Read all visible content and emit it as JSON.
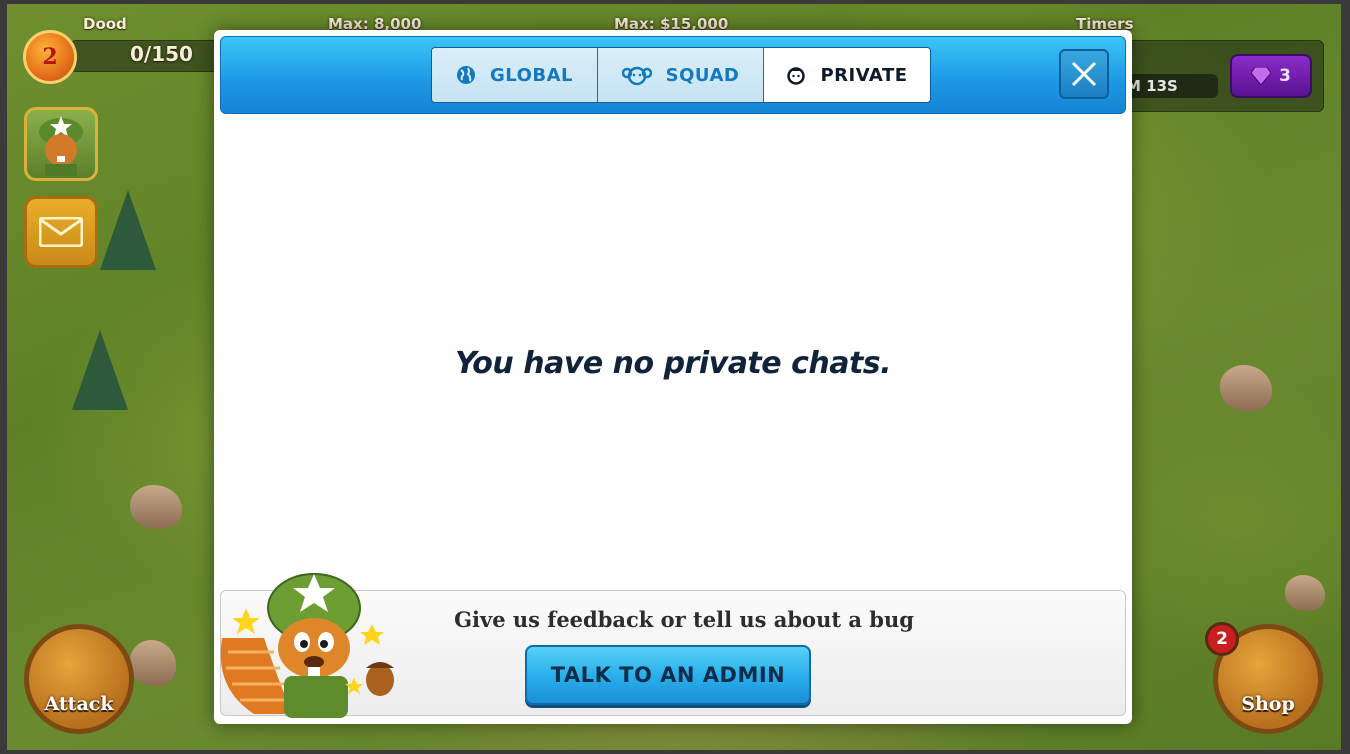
{
  "hud": {
    "player_name": "Dood",
    "level": "2",
    "wood_value": "0/150",
    "wood_max": "Max: 8,000",
    "cash_max": "Max: $15,000",
    "timers_label": "Timers",
    "timer_value": "M 13S",
    "gems": "3"
  },
  "modal": {
    "tabs": [
      {
        "label": "GLOBAL",
        "icon": "globe-icon",
        "active": false
      },
      {
        "label": "SQUAD",
        "icon": "squad-icon",
        "active": false
      },
      {
        "label": "PRIVATE",
        "icon": "person-icon",
        "active": true
      }
    ],
    "empty_message": "You have no private chats.",
    "feedback_text": "Give us feedback or tell us about a bug",
    "admin_button": "TALK TO AN ADMIN"
  },
  "bottom": {
    "attack_label": "Attack",
    "shop_label": "Shop",
    "shop_badge": "2"
  },
  "colors": {
    "header_blue": "#1e9be6",
    "active_tab_text": "#0d1b2a",
    "inactive_tab_text": "#1479bd",
    "gem_purple": "#8a2cc9"
  }
}
